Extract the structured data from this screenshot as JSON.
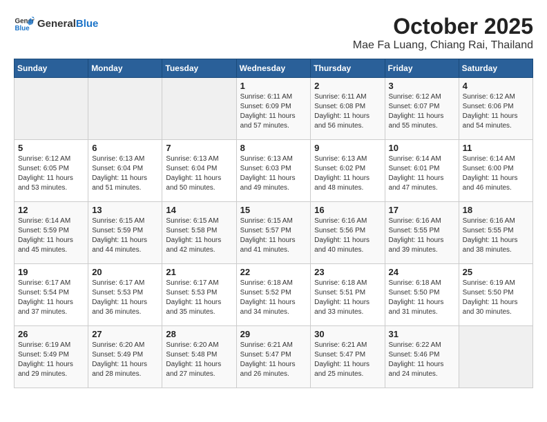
{
  "header": {
    "logo_general": "General",
    "logo_blue": "Blue",
    "title": "October 2025",
    "location": "Mae Fa Luang, Chiang Rai, Thailand"
  },
  "weekdays": [
    "Sunday",
    "Monday",
    "Tuesday",
    "Wednesday",
    "Thursday",
    "Friday",
    "Saturday"
  ],
  "weeks": [
    [
      {
        "day": "",
        "info": ""
      },
      {
        "day": "",
        "info": ""
      },
      {
        "day": "",
        "info": ""
      },
      {
        "day": "1",
        "info": "Sunrise: 6:11 AM\nSunset: 6:09 PM\nDaylight: 11 hours and 57 minutes."
      },
      {
        "day": "2",
        "info": "Sunrise: 6:11 AM\nSunset: 6:08 PM\nDaylight: 11 hours and 56 minutes."
      },
      {
        "day": "3",
        "info": "Sunrise: 6:12 AM\nSunset: 6:07 PM\nDaylight: 11 hours and 55 minutes."
      },
      {
        "day": "4",
        "info": "Sunrise: 6:12 AM\nSunset: 6:06 PM\nDaylight: 11 hours and 54 minutes."
      }
    ],
    [
      {
        "day": "5",
        "info": "Sunrise: 6:12 AM\nSunset: 6:05 PM\nDaylight: 11 hours and 53 minutes."
      },
      {
        "day": "6",
        "info": "Sunrise: 6:13 AM\nSunset: 6:04 PM\nDaylight: 11 hours and 51 minutes."
      },
      {
        "day": "7",
        "info": "Sunrise: 6:13 AM\nSunset: 6:04 PM\nDaylight: 11 hours and 50 minutes."
      },
      {
        "day": "8",
        "info": "Sunrise: 6:13 AM\nSunset: 6:03 PM\nDaylight: 11 hours and 49 minutes."
      },
      {
        "day": "9",
        "info": "Sunrise: 6:13 AM\nSunset: 6:02 PM\nDaylight: 11 hours and 48 minutes."
      },
      {
        "day": "10",
        "info": "Sunrise: 6:14 AM\nSunset: 6:01 PM\nDaylight: 11 hours and 47 minutes."
      },
      {
        "day": "11",
        "info": "Sunrise: 6:14 AM\nSunset: 6:00 PM\nDaylight: 11 hours and 46 minutes."
      }
    ],
    [
      {
        "day": "12",
        "info": "Sunrise: 6:14 AM\nSunset: 5:59 PM\nDaylight: 11 hours and 45 minutes."
      },
      {
        "day": "13",
        "info": "Sunrise: 6:15 AM\nSunset: 5:59 PM\nDaylight: 11 hours and 44 minutes."
      },
      {
        "day": "14",
        "info": "Sunrise: 6:15 AM\nSunset: 5:58 PM\nDaylight: 11 hours and 42 minutes."
      },
      {
        "day": "15",
        "info": "Sunrise: 6:15 AM\nSunset: 5:57 PM\nDaylight: 11 hours and 41 minutes."
      },
      {
        "day": "16",
        "info": "Sunrise: 6:16 AM\nSunset: 5:56 PM\nDaylight: 11 hours and 40 minutes."
      },
      {
        "day": "17",
        "info": "Sunrise: 6:16 AM\nSunset: 5:55 PM\nDaylight: 11 hours and 39 minutes."
      },
      {
        "day": "18",
        "info": "Sunrise: 6:16 AM\nSunset: 5:55 PM\nDaylight: 11 hours and 38 minutes."
      }
    ],
    [
      {
        "day": "19",
        "info": "Sunrise: 6:17 AM\nSunset: 5:54 PM\nDaylight: 11 hours and 37 minutes."
      },
      {
        "day": "20",
        "info": "Sunrise: 6:17 AM\nSunset: 5:53 PM\nDaylight: 11 hours and 36 minutes."
      },
      {
        "day": "21",
        "info": "Sunrise: 6:17 AM\nSunset: 5:53 PM\nDaylight: 11 hours and 35 minutes."
      },
      {
        "day": "22",
        "info": "Sunrise: 6:18 AM\nSunset: 5:52 PM\nDaylight: 11 hours and 34 minutes."
      },
      {
        "day": "23",
        "info": "Sunrise: 6:18 AM\nSunset: 5:51 PM\nDaylight: 11 hours and 33 minutes."
      },
      {
        "day": "24",
        "info": "Sunrise: 6:18 AM\nSunset: 5:50 PM\nDaylight: 11 hours and 31 minutes."
      },
      {
        "day": "25",
        "info": "Sunrise: 6:19 AM\nSunset: 5:50 PM\nDaylight: 11 hours and 30 minutes."
      }
    ],
    [
      {
        "day": "26",
        "info": "Sunrise: 6:19 AM\nSunset: 5:49 PM\nDaylight: 11 hours and 29 minutes."
      },
      {
        "day": "27",
        "info": "Sunrise: 6:20 AM\nSunset: 5:49 PM\nDaylight: 11 hours and 28 minutes."
      },
      {
        "day": "28",
        "info": "Sunrise: 6:20 AM\nSunset: 5:48 PM\nDaylight: 11 hours and 27 minutes."
      },
      {
        "day": "29",
        "info": "Sunrise: 6:21 AM\nSunset: 5:47 PM\nDaylight: 11 hours and 26 minutes."
      },
      {
        "day": "30",
        "info": "Sunrise: 6:21 AM\nSunset: 5:47 PM\nDaylight: 11 hours and 25 minutes."
      },
      {
        "day": "31",
        "info": "Sunrise: 6:22 AM\nSunset: 5:46 PM\nDaylight: 11 hours and 24 minutes."
      },
      {
        "day": "",
        "info": ""
      }
    ]
  ]
}
